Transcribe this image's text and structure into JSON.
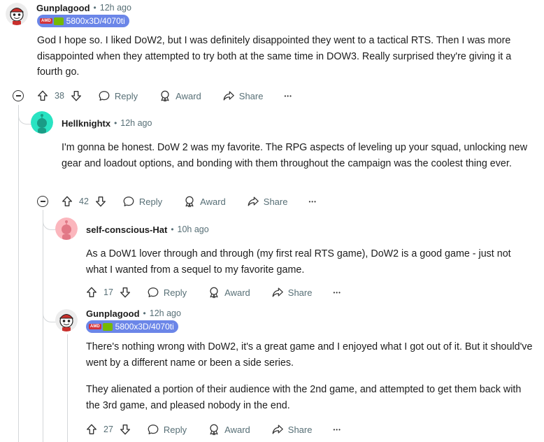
{
  "comments": [
    {
      "username": "Gunplagood",
      "time": "12h ago",
      "flair": "5800x3D/4070ti",
      "flair_amd": "AMD",
      "paragraphs": [
        "God I hope so. I liked DoW2, but I was definitely disappointed they went to a tactical RTS. Then I was more disappointed when they attempted to try both at the same time in DOW3. Really surprised they're giving it a fourth go."
      ],
      "votes": "38"
    },
    {
      "username": "Hellknightx",
      "time": "12h ago",
      "paragraphs": [
        "I'm gonna be honest. DoW 2 was my favorite. The RPG aspects of leveling up your squad, unlocking new gear and loadout options, and bonding with them throughout the campaign was the coolest thing ever."
      ],
      "votes": "42"
    },
    {
      "username": "self-conscious-Hat",
      "time": "10h ago",
      "paragraphs": [
        "As a DoW1 lover through and through (my first real RTS game), DoW2 is a good game - just not what I wanted from a sequel to my favorite game."
      ],
      "votes": "17"
    },
    {
      "username": "Gunplagood",
      "time": "12h ago",
      "flair": "5800x3D/4070ti",
      "flair_amd": "AMD",
      "paragraphs": [
        "There's nothing wrong with DoW2, it's a great game and I enjoyed what I got out of it. But it should've went by a different name or been a side series.",
        "They alienated a portion of their audience with the 2nd game, and attempted to get them back with the 3rd game, and pleased nobody in the end."
      ],
      "votes": "27"
    }
  ],
  "labels": {
    "reply": "Reply",
    "award": "Award",
    "share": "Share",
    "more": "•••",
    "separator": "•"
  },
  "colors": {
    "flair_bg": "#6b86e8",
    "hellknightx_avatar": "#29e3c2",
    "selfconscious_avatar": "#fbb6bd",
    "thread_line": "#d4d7d9"
  },
  "icons": [
    "collapse-icon",
    "upvote-icon",
    "downvote-icon",
    "reply-icon",
    "award-icon",
    "share-icon",
    "more-icon"
  ]
}
